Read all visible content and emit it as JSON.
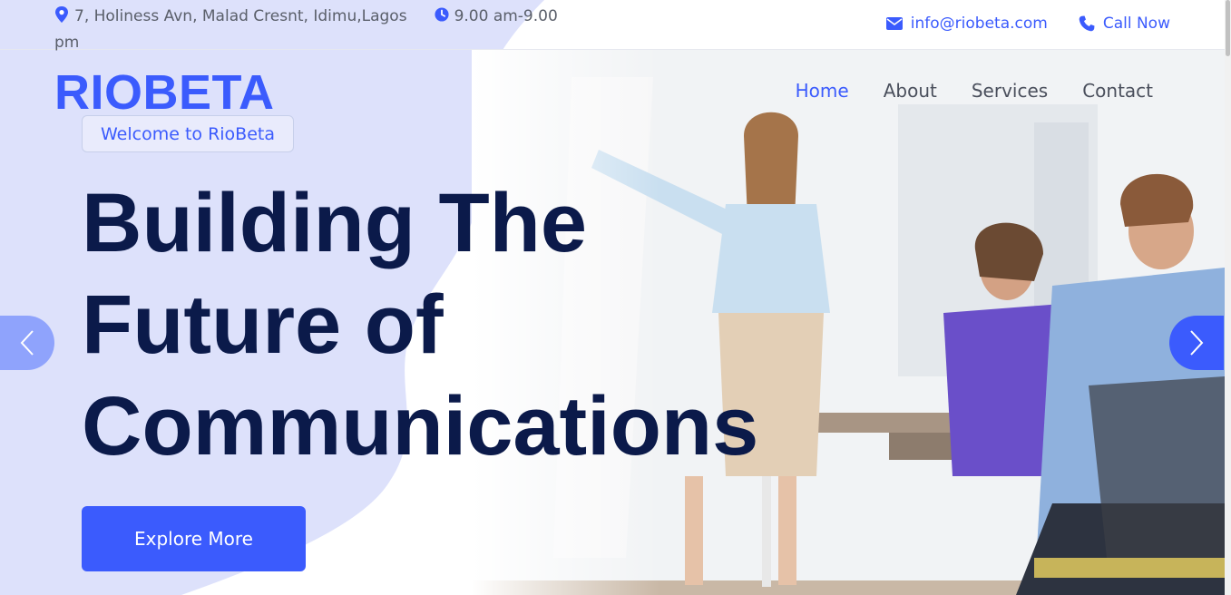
{
  "topbar": {
    "address": "7, Holiness Avn, Malad Cresnt, Idimu,Lagos",
    "hours": "9.00 am-9.00 pm",
    "email": "info@riobeta.com",
    "call": "Call Now"
  },
  "brand": {
    "logo": "RIOBETA"
  },
  "nav": {
    "items": [
      {
        "label": "Home",
        "active": true
      },
      {
        "label": "About"
      },
      {
        "label": "Services"
      },
      {
        "label": "Contact"
      }
    ]
  },
  "hero": {
    "badge": "Welcome to RioBeta",
    "title": "Building The Future of Communications",
    "cta": "Explore More"
  },
  "colors": {
    "accent": "#3b5bfd",
    "heading": "#0b1a4a",
    "blob": "#dde1fb"
  },
  "icons": [
    "map-marker-icon",
    "clock-icon",
    "envelope-icon",
    "phone-icon",
    "chevron-left-icon",
    "chevron-right-icon"
  ]
}
